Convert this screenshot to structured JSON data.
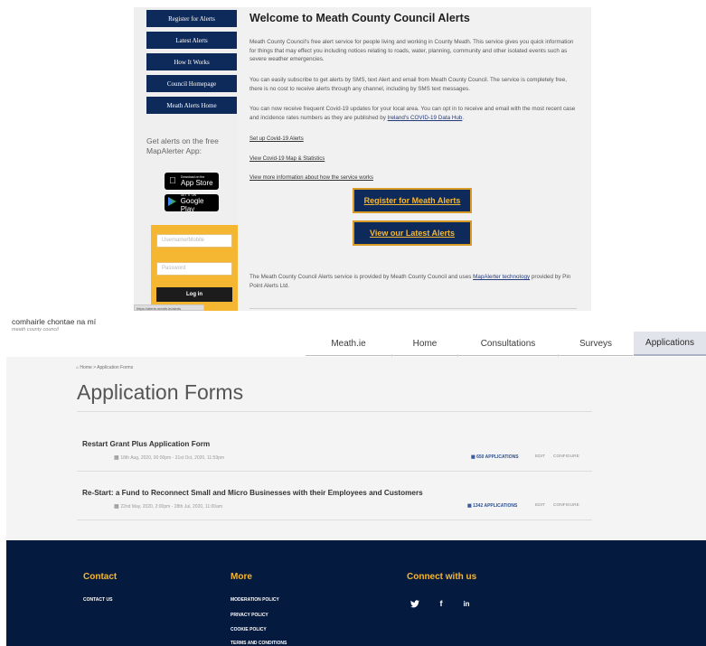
{
  "alerts_site": {
    "sidebar": {
      "items": [
        {
          "label": "Register for Alerts"
        },
        {
          "label": "Latest Alerts"
        },
        {
          "label": "How It Works"
        },
        {
          "label": "Council Homepage"
        },
        {
          "label": "Meath Alerts Home"
        }
      ],
      "app_text": "Get alerts on the free MapAlerter App:",
      "app_store": {
        "small": "Download on the",
        "big": "App Store"
      },
      "google_play": {
        "small": "GET IT ON",
        "big": "Google Play"
      },
      "login": {
        "username_placeholder": "Username/Mobile",
        "password_placeholder": "Password",
        "button_label": "Log in"
      },
      "status_url": "https://alerts.meath.ie/alerts"
    },
    "main": {
      "title": "Welcome to Meath County Council Alerts",
      "para1": "Meath County Council's free alert service for people living and working in County Meath. This service gives you quick information for things that may effect you including notices relating to roads, water, planning, community and other isolated events such as severe weather emergencies.",
      "para2": "You can easily subscribe to get alerts by SMS, text Alert and email from Meath County Council. The service is completely free, there is no cost to receive alerts through any channel, including by SMS text messages.",
      "para3_start": "You can now receive frequent Covid-19 updates for your local area. You can opt in to receive and email with the most recent case and incidence rates numbers as they are published by ",
      "para3_link": "Ireland's COVID-19 Data Hub",
      "para3_end": ".",
      "links": [
        "Set up Covid-19 Alerts",
        "View Covid-19 Map & Statistics",
        "View more information about how the service works"
      ],
      "cta_register": "Register for Meath Alerts",
      "cta_latest": "View our Latest Alerts",
      "footer_start": "The Meath County Council Alerts service is provided by Meath County Council and uses ",
      "footer_link": "MapAlerter technology",
      "footer_end": " provided by Pin Point Alerts Ltd."
    }
  },
  "portal": {
    "org_name": "comhairle chontae na mí",
    "org_sub": "meath county council",
    "nav": [
      "Meath.ie",
      "Home",
      "Consultations",
      "Surveys",
      "Applications"
    ],
    "breadcrumb": "Home > Application Forms",
    "page_title": "Application Forms",
    "forms": [
      {
        "title": "Restart Grant Plus Application Form",
        "dates": "18th Aug, 2020, 00:00pm - 31st Oct, 2020, 11:59pm",
        "count": "650 APPLICATIONS",
        "edit": "EDIT",
        "configure": "CONFIGURE"
      },
      {
        "title": "Re-Start: a Fund to Reconnect Small and Micro Businesses with their Employees and Customers",
        "dates": "22nd May, 2020, 2:00pm - 28th Jul, 2020, 11:00am",
        "count": "1342 APPLICATIONS",
        "edit": "EDIT",
        "configure": "CONFIGURE"
      }
    ],
    "footer": {
      "contact_heading": "Contact",
      "contact_link": "CONTACT US",
      "more_heading": "More",
      "more_links": [
        "MODERATION POLICY",
        "PRIVACY POLICY",
        "COOKIE POLICY",
        "TERMS AND CONDITIONS"
      ],
      "connect_heading": "Connect with us",
      "social": [
        "twitter-icon",
        "facebook-icon",
        "linkedin-icon"
      ]
    }
  },
  "colors": {
    "navy": "#0e2a5a",
    "gold": "#f5b731",
    "footer_bg": "#041a3f"
  }
}
